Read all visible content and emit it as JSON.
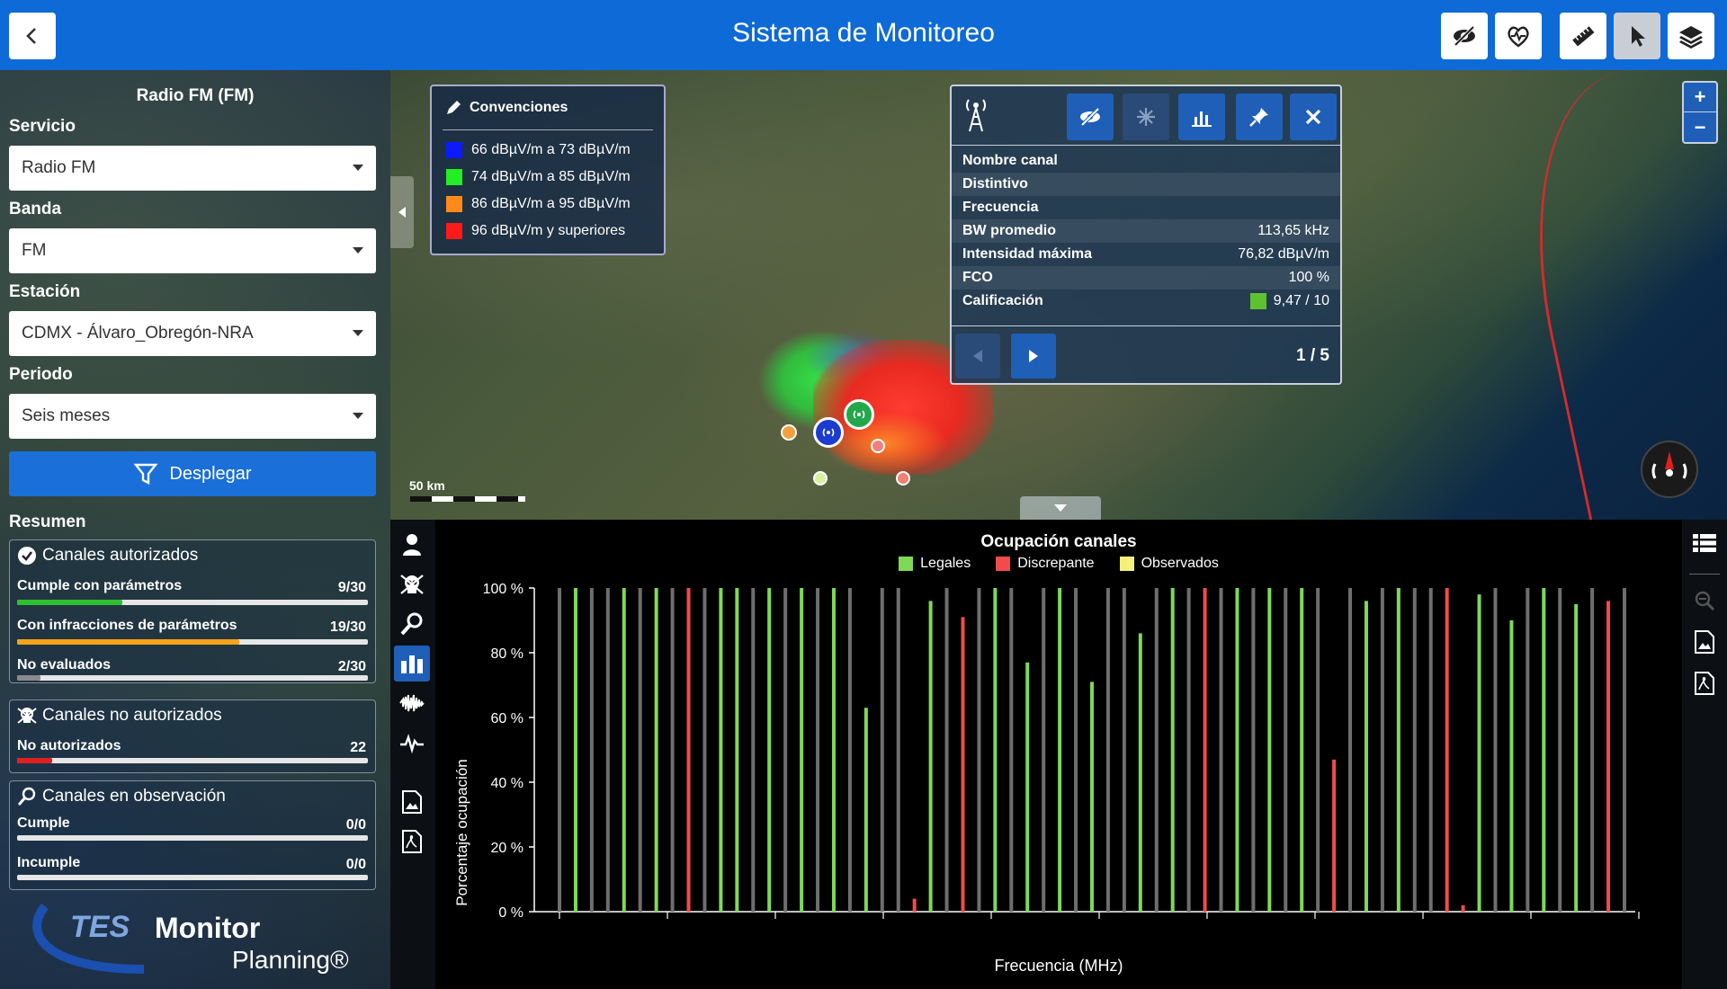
{
  "app": {
    "title": "Sistema de Monitoreo"
  },
  "sidebar": {
    "title": "Radio FM (FM)",
    "service": {
      "label": "Servicio",
      "value": "Radio FM"
    },
    "band": {
      "label": "Banda",
      "value": "FM"
    },
    "station": {
      "label": "Estación",
      "value": "CDMX - Álvaro_Obregón-NRA"
    },
    "period": {
      "label": "Periodo",
      "value": "Seis meses"
    },
    "deploy_label": "Desplegar",
    "summary_label": "Resumen",
    "authorized": {
      "title": "Canales autorizados",
      "rows": [
        {
          "label": "Cumple con parámetros",
          "count": "9/30",
          "fraction": 0.3,
          "color": "#2ec02e"
        },
        {
          "label": "Con infracciones de parámetros",
          "count": "19/30",
          "fraction": 0.633,
          "color": "#f5a31a"
        },
        {
          "label": "No evaluados",
          "count": "2/30",
          "fraction": 0.067,
          "color": "#8a8a8a"
        }
      ]
    },
    "unauthorized": {
      "title": "Canales no autorizados",
      "rows": [
        {
          "label": "No autorizados",
          "count": "22",
          "fraction": 0.1,
          "color": "#e02020"
        }
      ]
    },
    "observation": {
      "title": "Canales en observación",
      "rows": [
        {
          "label": "Cumple",
          "count": "0/0",
          "fraction": 0,
          "color": "#8a8a8a"
        },
        {
          "label": "Incumple",
          "count": "0/0",
          "fraction": 0,
          "color": "#8a8a8a"
        }
      ]
    },
    "logo": {
      "brand": "TES",
      "name": "Monitor",
      "sub": "Planning®"
    }
  },
  "map": {
    "legend": {
      "title": "Convenciones",
      "items": [
        {
          "label": "66 dBµV/m a 73 dBµV/m",
          "color": "#0a1cff"
        },
        {
          "label": "74 dBµV/m a 85 dBµV/m",
          "color": "#22ee22"
        },
        {
          "label": "86 dBµV/m a 95 dBµV/m",
          "color": "#ff8a1a"
        },
        {
          "label": "96 dBµV/m y superiores",
          "color": "#ff1a1a"
        }
      ]
    },
    "scale_label": "50 km",
    "info": {
      "rows": [
        {
          "key": "Nombre canal",
          "value": ""
        },
        {
          "key": "Distintivo",
          "value": ""
        },
        {
          "key": "Frecuencia",
          "value": ""
        },
        {
          "key": "BW promedio",
          "value": "113,65 kHz"
        },
        {
          "key": "Intensidad máxima",
          "value": "76,82 dBµV/m"
        },
        {
          "key": "FCO",
          "value": "100 %"
        },
        {
          "key": "Calificación",
          "value": "9,47 / 10"
        }
      ],
      "rating_color": "#5ec22e",
      "pager": "1 / 5"
    },
    "zoom_in": "+",
    "zoom_out": "−"
  },
  "chart_data": {
    "type": "bar",
    "title": "Ocupación canales",
    "xlabel": "Frecuencia (MHz)",
    "ylabel": "Porcentaje ocupación",
    "ylim": [
      0,
      100
    ],
    "yticks": [
      "0 %",
      "20 %",
      "40 %",
      "60 %",
      "80 %",
      "100 %"
    ],
    "legend": [
      {
        "name": "Legales",
        "color": "#7ed957"
      },
      {
        "name": "Discrepante",
        "color": "#f24b4b"
      },
      {
        "name": "Observados",
        "color": "#f5f07a"
      }
    ],
    "grid": false,
    "bars": [
      {
        "x": 0,
        "value": 100,
        "type": "gray"
      },
      {
        "x": 1,
        "value": 100,
        "type": "legal"
      },
      {
        "x": 2,
        "value": 100,
        "type": "gray"
      },
      {
        "x": 3,
        "value": 100,
        "type": "gray"
      },
      {
        "x": 4,
        "value": 100,
        "type": "legal"
      },
      {
        "x": 5,
        "value": 100,
        "type": "gray"
      },
      {
        "x": 6,
        "value": 100,
        "type": "legal"
      },
      {
        "x": 7,
        "value": 100,
        "type": "gray"
      },
      {
        "x": 8,
        "value": 100,
        "type": "discrepante"
      },
      {
        "x": 9,
        "value": 100,
        "type": "gray"
      },
      {
        "x": 10,
        "value": 100,
        "type": "legal"
      },
      {
        "x": 11,
        "value": 100,
        "type": "legal"
      },
      {
        "x": 12,
        "value": 100,
        "type": "gray"
      },
      {
        "x": 13,
        "value": 100,
        "type": "legal"
      },
      {
        "x": 14,
        "value": 100,
        "type": "gray"
      },
      {
        "x": 15,
        "value": 100,
        "type": "legal"
      },
      {
        "x": 16,
        "value": 100,
        "type": "gray"
      },
      {
        "x": 17,
        "value": 100,
        "type": "legal"
      },
      {
        "x": 18,
        "value": 100,
        "type": "gray"
      },
      {
        "x": 19,
        "value": 63,
        "type": "legal"
      },
      {
        "x": 20,
        "value": 100,
        "type": "gray"
      },
      {
        "x": 21,
        "value": 100,
        "type": "gray"
      },
      {
        "x": 22,
        "value": 4,
        "type": "discrepante"
      },
      {
        "x": 23,
        "value": 96,
        "type": "legal"
      },
      {
        "x": 24,
        "value": 100,
        "type": "gray"
      },
      {
        "x": 25,
        "value": 91,
        "type": "discrepante"
      },
      {
        "x": 26,
        "value": 100,
        "type": "gray"
      },
      {
        "x": 27,
        "value": 100,
        "type": "legal"
      },
      {
        "x": 28,
        "value": 100,
        "type": "gray"
      },
      {
        "x": 29,
        "value": 77,
        "type": "legal"
      },
      {
        "x": 30,
        "value": 100,
        "type": "gray"
      },
      {
        "x": 31,
        "value": 100,
        "type": "legal"
      },
      {
        "x": 32,
        "value": 100,
        "type": "gray"
      },
      {
        "x": 33,
        "value": 71,
        "type": "legal"
      },
      {
        "x": 34,
        "value": 100,
        "type": "gray"
      },
      {
        "x": 35,
        "value": 100,
        "type": "gray"
      },
      {
        "x": 36,
        "value": 86,
        "type": "legal"
      },
      {
        "x": 37,
        "value": 100,
        "type": "gray"
      },
      {
        "x": 38,
        "value": 100,
        "type": "legal"
      },
      {
        "x": 39,
        "value": 100,
        "type": "gray"
      },
      {
        "x": 40,
        "value": 100,
        "type": "discrepante"
      },
      {
        "x": 41,
        "value": 100,
        "type": "gray"
      },
      {
        "x": 42,
        "value": 100,
        "type": "legal"
      },
      {
        "x": 43,
        "value": 100,
        "type": "gray"
      },
      {
        "x": 44,
        "value": 100,
        "type": "legal"
      },
      {
        "x": 45,
        "value": 100,
        "type": "gray"
      },
      {
        "x": 46,
        "value": 100,
        "type": "legal"
      },
      {
        "x": 47,
        "value": 100,
        "type": "gray"
      },
      {
        "x": 48,
        "value": 47,
        "type": "discrepante"
      },
      {
        "x": 49,
        "value": 100,
        "type": "gray"
      },
      {
        "x": 50,
        "value": 96,
        "type": "legal"
      },
      {
        "x": 51,
        "value": 100,
        "type": "gray"
      },
      {
        "x": 52,
        "value": 100,
        "type": "legal"
      },
      {
        "x": 53,
        "value": 100,
        "type": "gray"
      },
      {
        "x": 54,
        "value": 100,
        "type": "gray"
      },
      {
        "x": 55,
        "value": 100,
        "type": "discrepante"
      },
      {
        "x": 56,
        "value": 2,
        "type": "discrepante"
      },
      {
        "x": 57,
        "value": 98,
        "type": "legal"
      },
      {
        "x": 58,
        "value": 100,
        "type": "gray"
      },
      {
        "x": 59,
        "value": 90,
        "type": "legal"
      },
      {
        "x": 60,
        "value": 100,
        "type": "gray"
      },
      {
        "x": 61,
        "value": 100,
        "type": "legal"
      },
      {
        "x": 62,
        "value": 100,
        "type": "gray"
      },
      {
        "x": 63,
        "value": 95,
        "type": "legal"
      },
      {
        "x": 64,
        "value": 100,
        "type": "gray"
      },
      {
        "x": 65,
        "value": 96,
        "type": "discrepante"
      },
      {
        "x": 66,
        "value": 100,
        "type": "gray"
      }
    ]
  }
}
